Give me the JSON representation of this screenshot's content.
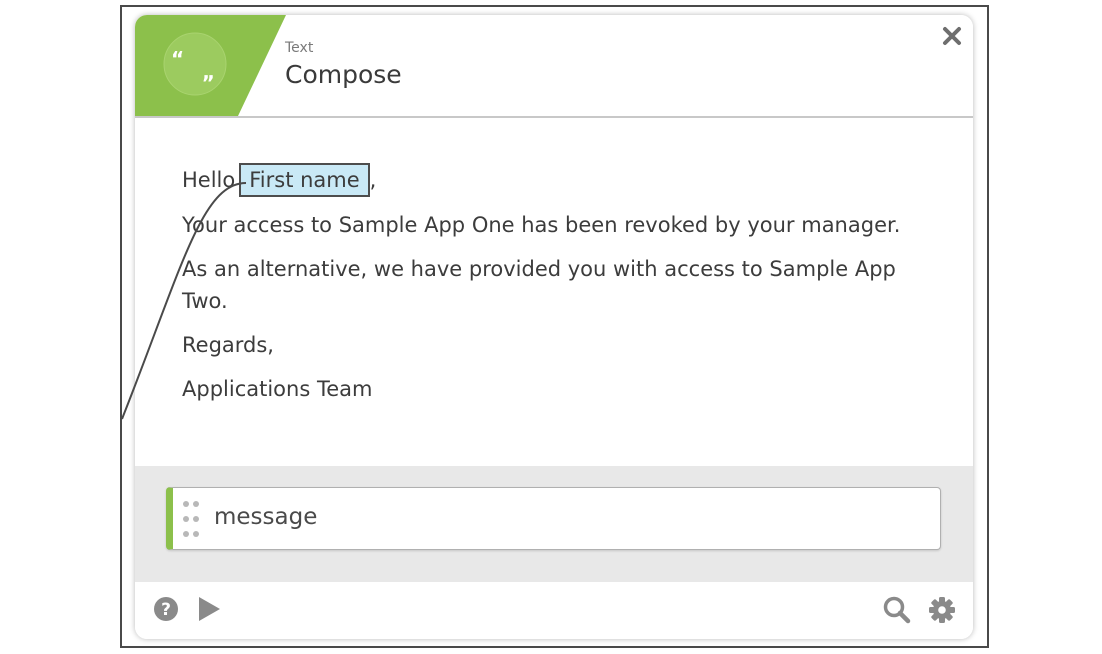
{
  "window": {
    "type_label": "Text",
    "title": "Compose"
  },
  "header": {
    "accent_color": "#8cc04b",
    "icon": "quote-icon",
    "quote_glyph": "“ ,,"
  },
  "message": {
    "greeting_prefix": "Hello",
    "token_label": "First name",
    "greeting_suffix": ",",
    "line_access": "Your access to Sample App One has been revoked by your manager.",
    "line_alternative": "As an alternative, we have provided you with access to Sample App Two.",
    "line_regards": "Regards,",
    "line_signature": "Applications Team"
  },
  "output": {
    "field_label": "message",
    "field_accent_color": "#8cc04b"
  },
  "footer": {
    "left_icons": [
      "help-icon",
      "play-icon"
    ],
    "right_icons": [
      "search-icon",
      "gear-icon"
    ]
  },
  "colors": {
    "token_bg": "#c9e9f6",
    "tray_bg": "#e8e8e8",
    "icon_gray": "#8a8a8a"
  }
}
